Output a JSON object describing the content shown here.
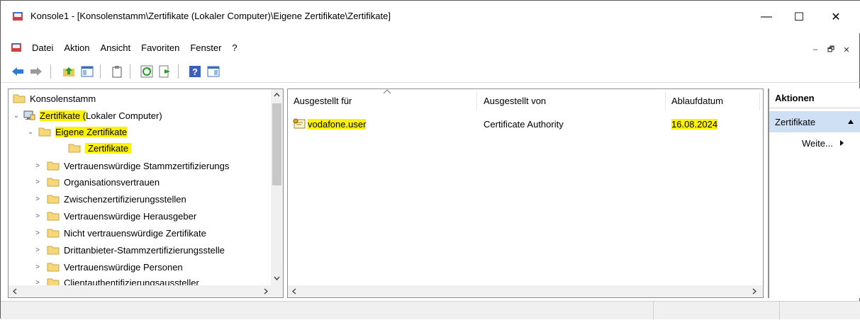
{
  "window": {
    "title": "Konsole1 - [Konsolenstamm\\Zertifikate (Lokaler Computer)\\Eigene Zertifikate\\Zertifikate]",
    "minimize": "—",
    "maximize": "☐",
    "close": "✕"
  },
  "menu": {
    "items": [
      "Datei",
      "Aktion",
      "Ansicht",
      "Favoriten",
      "Fenster",
      "?"
    ],
    "mdi": [
      "–",
      "🗗",
      "✕"
    ]
  },
  "tree": {
    "items": [
      {
        "label": "Konsolenstamm",
        "arrow": ""
      },
      {
        "label_hl": "Zertifikate (",
        "label_rest": "Lokaler Computer)",
        "arrow": "⌄"
      },
      {
        "label": "Eigene Zertifikate",
        "arrow": "⌄"
      },
      {
        "label": "Zertifikate",
        "arrow": ""
      },
      {
        "label": "Vertrauenswürdige Stammzertifizierungs",
        "arrow": ">"
      },
      {
        "label": "Organisationsvertrauen",
        "arrow": ">"
      },
      {
        "label": "Zwischenzertifizierungsstellen",
        "arrow": ">"
      },
      {
        "label": "Vertrauenswürdige Herausgeber",
        "arrow": ">"
      },
      {
        "label": "Nicht vertrauenswürdige Zertifikate",
        "arrow": ">"
      },
      {
        "label": "Drittanbieter-Stammzertifizierungsstelle",
        "arrow": ">"
      },
      {
        "label": "Vertrauenswürdige Personen",
        "arrow": ">"
      },
      {
        "label": "Clientauthentifizierungsaussteller",
        "arrow": ">"
      }
    ]
  },
  "list": {
    "columns": [
      "Ausgestellt für",
      "Ausgestellt von",
      "Ablaufdatum"
    ],
    "rows": [
      {
        "issued_to": "vodafone.user",
        "issued_by": "Certificate Authority",
        "expires": "16.08.2024"
      }
    ]
  },
  "actions": {
    "title": "Aktionen",
    "section": "Zertifikate",
    "item": "Weite..."
  },
  "colors": {
    "highlight": "#fff200",
    "selection": "#cfe0f4"
  }
}
